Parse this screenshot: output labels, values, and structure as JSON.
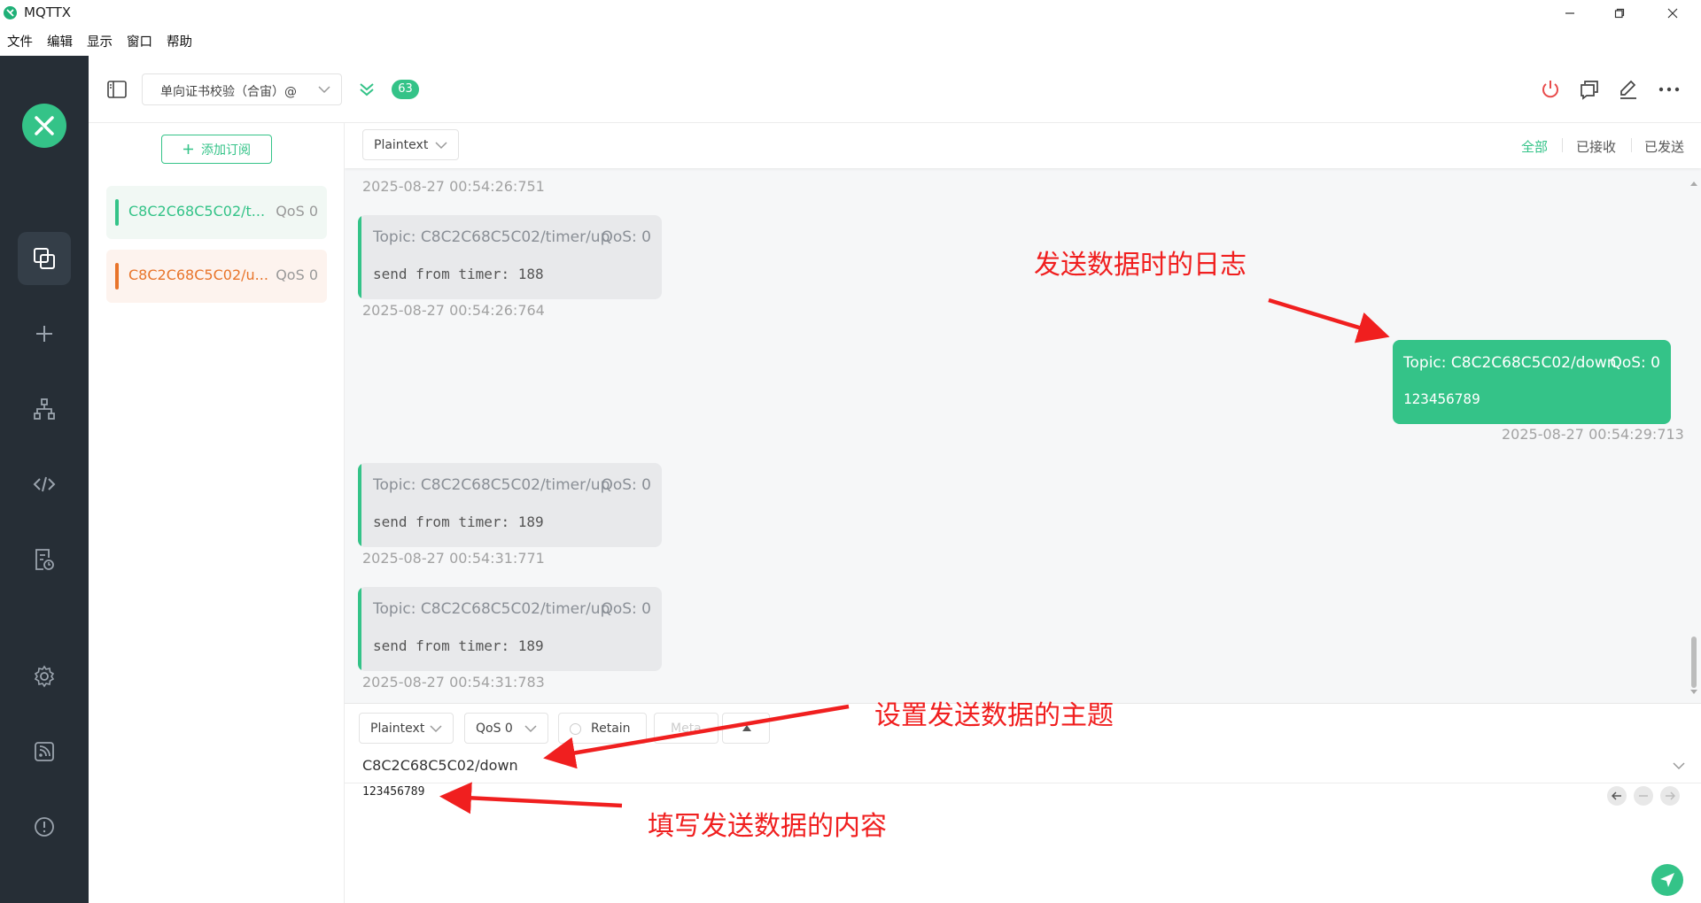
{
  "window": {
    "title": "MQTTX",
    "menu": [
      "文件",
      "编辑",
      "显示",
      "窗口",
      "帮助"
    ]
  },
  "header": {
    "connection_name": "单向证书校验（合宙）@",
    "message_count": "63"
  },
  "subscriptions": {
    "add_label": "添加订阅",
    "items": [
      {
        "topic": "C8C2C68C5C02/t...",
        "qos": "QoS 0",
        "color": "#34c388"
      },
      {
        "topic": "C8C2C68C5C02/u...",
        "qos": "QoS 0",
        "color": "#e8742a"
      }
    ]
  },
  "messages_toolbar": {
    "format": "Plaintext",
    "filters": [
      "全部",
      "已接收",
      "已发送"
    ]
  },
  "messages": [
    {
      "kind": "time",
      "text": "2025-08-27 00:54:26:751"
    },
    {
      "kind": "received",
      "topic": "Topic: C8C2C68C5C02/timer/up",
      "qos": "QoS: 0",
      "payload": "send from timer: 188",
      "time": "2025-08-27 00:54:26:764"
    },
    {
      "kind": "sent",
      "topic": "Topic: C8C2C68C5C02/down",
      "qos": "QoS: 0",
      "payload": "123456789",
      "time": "2025-08-27 00:54:29:713"
    },
    {
      "kind": "received",
      "topic": "Topic: C8C2C68C5C02/timer/up",
      "qos": "QoS: 0",
      "payload": "send from timer: 189",
      "time": "2025-08-27 00:54:31:771"
    },
    {
      "kind": "received",
      "topic": "Topic: C8C2C68C5C02/timer/up",
      "qos": "QoS: 0",
      "payload": "send from timer: 189",
      "time": "2025-08-27 00:54:31:783"
    }
  ],
  "publish": {
    "format": "Plaintext",
    "qos": "QoS 0",
    "retain_label": "Retain",
    "meta_label": "Meta",
    "topic": "C8C2C68C5C02/down",
    "payload": "123456789"
  },
  "annotations": {
    "log": "发送数据时的日志",
    "topic": "设置发送数据的主题",
    "content": "填写发送数据的内容"
  },
  "colors": {
    "accent": "#34c388",
    "nav_bg": "#262e36",
    "annotation": "#f01f1f",
    "danger": "#e84b4b",
    "second_sub": "#e8742a"
  },
  "icons": {
    "nav": [
      "connections-icon",
      "add-icon",
      "topology-icon",
      "script-icon",
      "log-icon",
      "settings-icon",
      "feed-icon",
      "about-icon"
    ],
    "header": [
      "sidebar-toggle-icon",
      "collapse-down-icon",
      "disconnect-icon",
      "new-window-icon",
      "edit-icon",
      "more-icon"
    ]
  }
}
